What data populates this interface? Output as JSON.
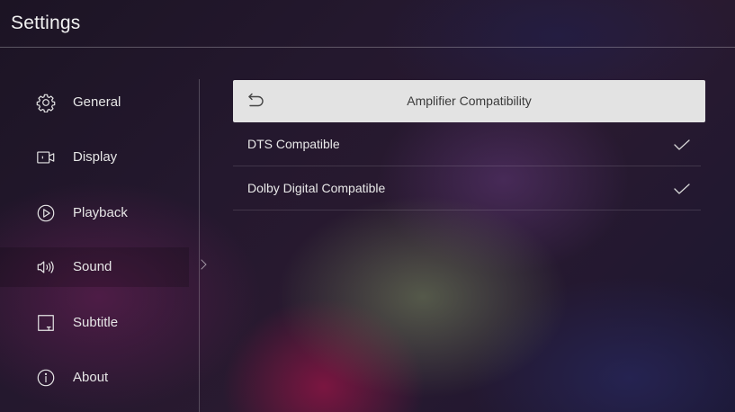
{
  "header": {
    "title": "Settings"
  },
  "sidebar": {
    "items": [
      {
        "label": "General",
        "icon": "gear-icon"
      },
      {
        "label": "Display",
        "icon": "display-icon"
      },
      {
        "label": "Playback",
        "icon": "play-icon"
      },
      {
        "label": "Sound",
        "icon": "speaker-icon",
        "selected": true
      },
      {
        "label": "Subtitle",
        "icon": "subtitle-icon"
      },
      {
        "label": "About",
        "icon": "info-icon"
      }
    ]
  },
  "panel": {
    "title": "Amplifier Compatibility",
    "back_icon": "back-arrow-icon",
    "options": [
      {
        "label": "DTS Compatible",
        "checked": true
      },
      {
        "label": "Dolby Digital Compatible",
        "checked": true
      }
    ]
  },
  "colors": {
    "header_bar": "#e3e3e3",
    "text": "#e6e6e6",
    "panel_text": "#3a3a3a"
  }
}
